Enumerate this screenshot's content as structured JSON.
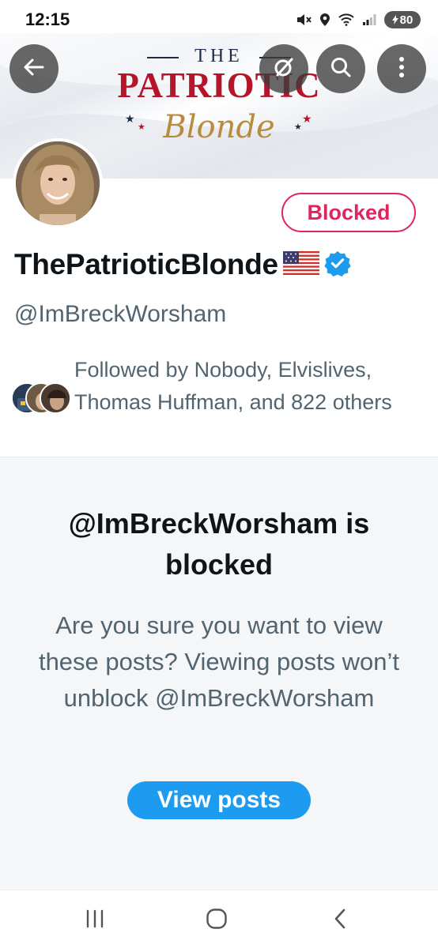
{
  "status_bar": {
    "time": "12:15",
    "battery": "80",
    "icons": [
      "mute-icon",
      "location-icon",
      "wifi-icon",
      "signal-icon",
      "battery-icon"
    ]
  },
  "banner": {
    "logo_the": "THE",
    "logo_patriotic": "PATRIOTIC",
    "logo_blonde": "Blonde",
    "actions": [
      "back-arrow-icon",
      "grok-icon",
      "search-icon",
      "more-vertical-icon"
    ]
  },
  "profile": {
    "blocked_label": "Blocked",
    "display_name": "ThePatrioticBlonde",
    "handle": "@ImBreckWorsham",
    "verified": true,
    "followed_by": "Followed by Nobody, Elvislives, Thomas Huffman, and 822 others"
  },
  "blocked_notice": {
    "title": "@ImBreckWorsham is blocked",
    "body": "Are you sure you want to view these posts? Viewing posts won’t unblock @ImBreckWorsham",
    "button": "View posts"
  },
  "nav_bar": {
    "buttons": [
      "recent-apps-icon",
      "home-icon",
      "back-icon"
    ]
  },
  "colors": {
    "blocked_red": "#e0245e",
    "accent_blue": "#1d9bf0",
    "secondary_text": "#536471",
    "panel_bg": "#f4f6f7",
    "logo_red": "#b5142b",
    "logo_gold": "#b98b3e",
    "logo_navy": "#1d2a4a"
  }
}
